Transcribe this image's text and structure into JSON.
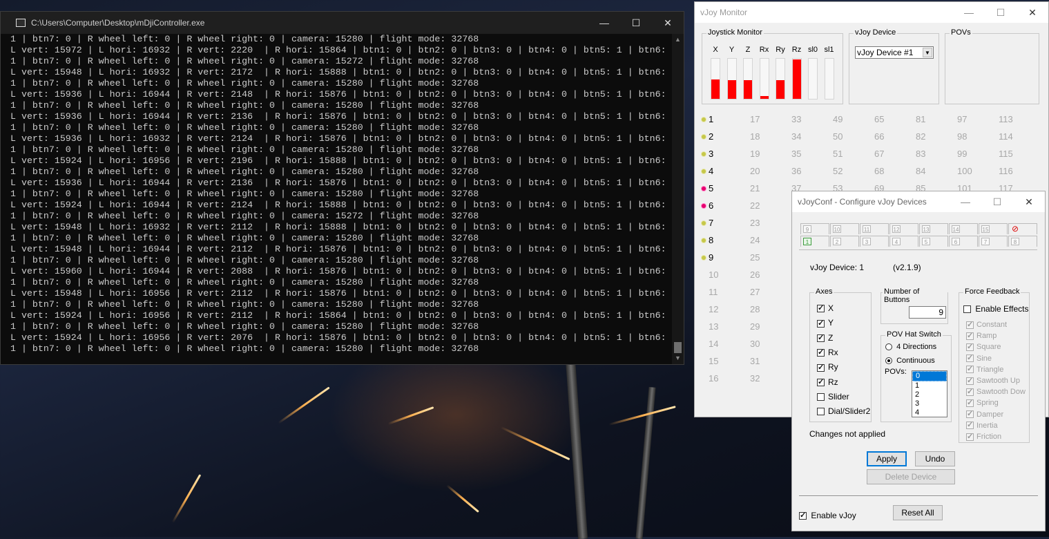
{
  "console": {
    "title": "C:\\Users\\Computer\\Desktop\\mDjiController.exe",
    "lines": [
      "1 | btn7: 0 | R wheel left: 0 | R wheel right: 0 | camera: 15280 | flight mode: 32768",
      "L vert: 15972 | L hori: 16932 | R vert: 2220  | R hori: 15864 | btn1: 0 | btn2: 0 | btn3: 0 | btn4: 0 | btn5: 1 | btn6:",
      "1 | btn7: 0 | R wheel left: 0 | R wheel right: 0 | camera: 15272 | flight mode: 32768",
      "L vert: 15948 | L hori: 16932 | R vert: 2172  | R hori: 15888 | btn1: 0 | btn2: 0 | btn3: 0 | btn4: 0 | btn5: 1 | btn6:",
      "1 | btn7: 0 | R wheel left: 0 | R wheel right: 0 | camera: 15280 | flight mode: 32768",
      "L vert: 15936 | L hori: 16944 | R vert: 2148  | R hori: 15876 | btn1: 0 | btn2: 0 | btn3: 0 | btn4: 0 | btn5: 1 | btn6:",
      "1 | btn7: 0 | R wheel left: 0 | R wheel right: 0 | camera: 15280 | flight mode: 32768",
      "L vert: 15936 | L hori: 16944 | R vert: 2136  | R hori: 15876 | btn1: 0 | btn2: 0 | btn3: 0 | btn4: 0 | btn5: 1 | btn6:",
      "1 | btn7: 0 | R wheel left: 0 | R wheel right: 0 | camera: 15280 | flight mode: 32768",
      "L vert: 15936 | L hori: 16932 | R vert: 2124  | R hori: 15876 | btn1: 0 | btn2: 0 | btn3: 0 | btn4: 0 | btn5: 1 | btn6:",
      "1 | btn7: 0 | R wheel left: 0 | R wheel right: 0 | camera: 15280 | flight mode: 32768",
      "L vert: 15924 | L hori: 16956 | R vert: 2196  | R hori: 15888 | btn1: 0 | btn2: 0 | btn3: 0 | btn4: 0 | btn5: 1 | btn6:",
      "1 | btn7: 0 | R wheel left: 0 | R wheel right: 0 | camera: 15280 | flight mode: 32768",
      "L vert: 15936 | L hori: 16944 | R vert: 2136  | R hori: 15876 | btn1: 0 | btn2: 0 | btn3: 0 | btn4: 0 | btn5: 1 | btn6:",
      "1 | btn7: 0 | R wheel left: 0 | R wheel right: 0 | camera: 15280 | flight mode: 32768",
      "L vert: 15924 | L hori: 16944 | R vert: 2124  | R hori: 15888 | btn1: 0 | btn2: 0 | btn3: 0 | btn4: 0 | btn5: 1 | btn6:",
      "1 | btn7: 0 | R wheel left: 0 | R wheel right: 0 | camera: 15272 | flight mode: 32768",
      "L vert: 15948 | L hori: 16932 | R vert: 2112  | R hori: 15888 | btn1: 0 | btn2: 0 | btn3: 0 | btn4: 0 | btn5: 1 | btn6:",
      "1 | btn7: 0 | R wheel left: 0 | R wheel right: 0 | camera: 15280 | flight mode: 32768",
      "L vert: 15948 | L hori: 16944 | R vert: 2112  | R hori: 15876 | btn1: 0 | btn2: 0 | btn3: 0 | btn4: 0 | btn5: 1 | btn6:",
      "1 | btn7: 0 | R wheel left: 0 | R wheel right: 0 | camera: 15280 | flight mode: 32768",
      "L vert: 15960 | L hori: 16944 | R vert: 2088  | R hori: 15876 | btn1: 0 | btn2: 0 | btn3: 0 | btn4: 0 | btn5: 1 | btn6:",
      "1 | btn7: 0 | R wheel left: 0 | R wheel right: 0 | camera: 15280 | flight mode: 32768",
      "L vert: 15948 | L hori: 16956 | R vert: 2112  | R hori: 15876 | btn1: 0 | btn2: 0 | btn3: 0 | btn4: 0 | btn5: 1 | btn6:",
      "1 | btn7: 0 | R wheel left: 0 | R wheel right: 0 | camera: 15280 | flight mode: 32768",
      "L vert: 15924 | L hori: 16956 | R vert: 2112  | R hori: 15864 | btn1: 0 | btn2: 0 | btn3: 0 | btn4: 0 | btn5: 1 | btn6:",
      "1 | btn7: 0 | R wheel left: 0 | R wheel right: 0 | camera: 15280 | flight mode: 32768",
      "L vert: 15924 | L hori: 16956 | R vert: 2076  | R hori: 15876 | btn1: 0 | btn2: 0 | btn3: 0 | btn4: 0 | btn5: 1 | btn6:",
      "1 | btn7: 0 | R wheel left: 0 | R wheel right: 0 | camera: 15280 | flight mode: 32768"
    ]
  },
  "window_buttons": {
    "minimize": "—",
    "maximize": "☐",
    "close": "✕"
  },
  "monitor": {
    "title": "vJoy Monitor",
    "joystick_group": "Joystick Monitor",
    "device_group": "vJoy Device",
    "povs_group": "POVs",
    "device_selected": "vJoy Device #1",
    "axes": [
      {
        "label": "X",
        "level": 0.48
      },
      {
        "label": "Y",
        "level": 0.47
      },
      {
        "label": "Z",
        "level": 0.47
      },
      {
        "label": "Rx",
        "level": 0.07
      },
      {
        "label": "Ry",
        "level": 0.46
      },
      {
        "label": "Rz",
        "level": 0.98
      },
      {
        "label": "sl0",
        "level": 0
      },
      {
        "label": "sl1",
        "level": 0
      }
    ],
    "buttons_active_count": 9,
    "buttons_pressed": [
      5,
      6
    ],
    "button_count_shown": 117,
    "accent_red": "#ff0000",
    "pressed_color": "#e6006e"
  },
  "conf": {
    "title": "vJoyConf - Configure vJoy Devices",
    "tabs_top": [
      "9",
      "10",
      "11",
      "12",
      "13",
      "14",
      "15",
      "⊘"
    ],
    "tabs_bottom": [
      "1",
      "2",
      "3",
      "4",
      "5",
      "6",
      "7",
      "8"
    ],
    "device_label": "vJoy Device: 1",
    "version": "(v2.1.9)",
    "axes_group": "Axes",
    "axes": [
      {
        "label": "X",
        "checked": true
      },
      {
        "label": "Y",
        "checked": true
      },
      {
        "label": "Z",
        "checked": true
      },
      {
        "label": "Rx",
        "checked": true
      },
      {
        "label": "Ry",
        "checked": true
      },
      {
        "label": "Rz",
        "checked": true
      },
      {
        "label": "Slider",
        "checked": false
      },
      {
        "label": "Dial/Slider2",
        "checked": false
      }
    ],
    "num_buttons_group": "Number of Buttons",
    "num_buttons_value": "9",
    "pov_group": "POV Hat Switch",
    "pov_4dir": "4 Directions",
    "pov_continuous": "Continuous",
    "povs_label": "POVs:",
    "pov_options": [
      "0",
      "1",
      "2",
      "3",
      "4"
    ],
    "pov_selected": "0",
    "ff_group": "Force Feedback",
    "ff_enable": "Enable Effects",
    "ff_effects": [
      "Constant",
      "Ramp",
      "Square",
      "Sine",
      "Triangle",
      "Sawtooth Up",
      "Sawtooth Dow",
      "Spring",
      "Damper",
      "Inertia",
      "Friction"
    ],
    "status": "Changes not applied",
    "apply": "Apply",
    "undo": "Undo",
    "delete": "Delete Device",
    "enable_vjoy": "Enable vJoy",
    "reset_all": "Reset All"
  }
}
